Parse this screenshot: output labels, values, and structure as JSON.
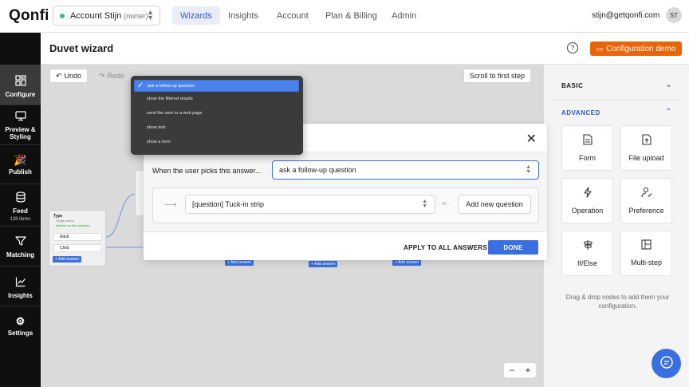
{
  "topbar": {
    "logo": "Qonfi",
    "account": {
      "name": "Account Stijn",
      "role": "(owner)"
    },
    "nav": [
      "Wizards",
      "Insights",
      "Account",
      "Plan & Billing",
      "Admin"
    ],
    "email": "stijn@getqonfi.com",
    "avatar": "ST"
  },
  "sidebar": {
    "items": [
      {
        "label": "Configure",
        "icon": "configure-icon"
      },
      {
        "label": "Preview & Styling",
        "icon": "monitor-icon"
      },
      {
        "label": "Publish",
        "icon": "party-popper-icon"
      },
      {
        "label": "Feed",
        "sub": "128 items",
        "icon": "database-icon"
      },
      {
        "label": "Matching",
        "icon": "funnel-icon"
      },
      {
        "label": "Insights",
        "icon": "chart-icon"
      },
      {
        "label": "Settings",
        "icon": "gear-icon"
      }
    ]
  },
  "header": {
    "title": "Duvet wizard",
    "help": "?",
    "demo_button": "Configuration demo"
  },
  "toolbar": {
    "undo": "Undo",
    "redo": "Redo",
    "scroll": "Scroll to first step"
  },
  "node": {
    "title": "Type",
    "subtitle": "Single select",
    "badge": "Marked as first question",
    "answers": [
      "Adult",
      "Child"
    ],
    "add_answer": "+ Add answer"
  },
  "canvas_add_buttons": [
    "+ Add answer",
    "+ Add answer",
    "+ Add answer"
  ],
  "zoom": {
    "minus": "−",
    "plus": "+"
  },
  "panel": {
    "basic_label": "BASIC",
    "advanced_label": "ADVANCED",
    "tiles": [
      {
        "label": "Form",
        "icon": "form-icon"
      },
      {
        "label": "File upload",
        "icon": "file-upload-icon"
      },
      {
        "label": "Operation",
        "icon": "operation-icon"
      },
      {
        "label": "Preference",
        "icon": "preference-icon"
      },
      {
        "label": "If/Else",
        "icon": "signpost-icon"
      },
      {
        "label": "Multi-step",
        "icon": "multi-step-icon"
      }
    ],
    "hint": "Drag & drop nodes to add them your configuration."
  },
  "modal": {
    "when_label": "When the user picks this answer...",
    "action_value": "ask a follow-up question",
    "question_value": "[question] Tuck-in strip",
    "or_label": "- or -",
    "add_question": "Add new question",
    "apply_all": "APPLY TO ALL ANSWERS",
    "done": "DONE"
  },
  "dropdown": {
    "options": [
      "ask a follow-up question",
      "show the filtered results",
      "send the user to a web page",
      "show text",
      "show a form"
    ],
    "selected": 0
  },
  "colors": {
    "accent": "#3a6fe0",
    "brand_orange": "#e8650b",
    "sidebar_bg": "#0f0f10"
  }
}
